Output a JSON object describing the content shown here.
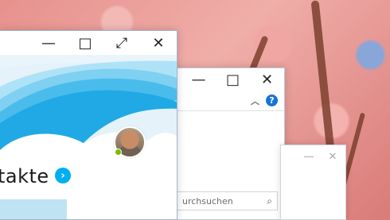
{
  "desktop": {
    "wallpaper": "cherry-blossom-branches"
  },
  "explorer_window": {
    "titlebar": {
      "minimize_icon": "minimize-icon",
      "maximize_icon": "maximize-icon",
      "close_icon": "close-icon"
    },
    "ribbon": {
      "collapse_icon": "chevron-up-icon",
      "help_icon": "help-icon"
    },
    "search": {
      "placeholder": "urchsuchen",
      "icon": "search-icon"
    }
  },
  "dialog_window": {
    "minimize_icon": "minimize-icon",
    "close_icon": "close-icon"
  },
  "skype_window": {
    "titlebar": {
      "minimize_icon": "minimize-icon",
      "maximize_icon": "maximize-icon",
      "expand_icon": "expand-icon",
      "close_icon": "close-icon"
    },
    "title_fragment": "takte",
    "avatar_status_color": "#7fba00",
    "accent_color": "#00aff0",
    "arrow_icon": "chevron-right-icon"
  }
}
